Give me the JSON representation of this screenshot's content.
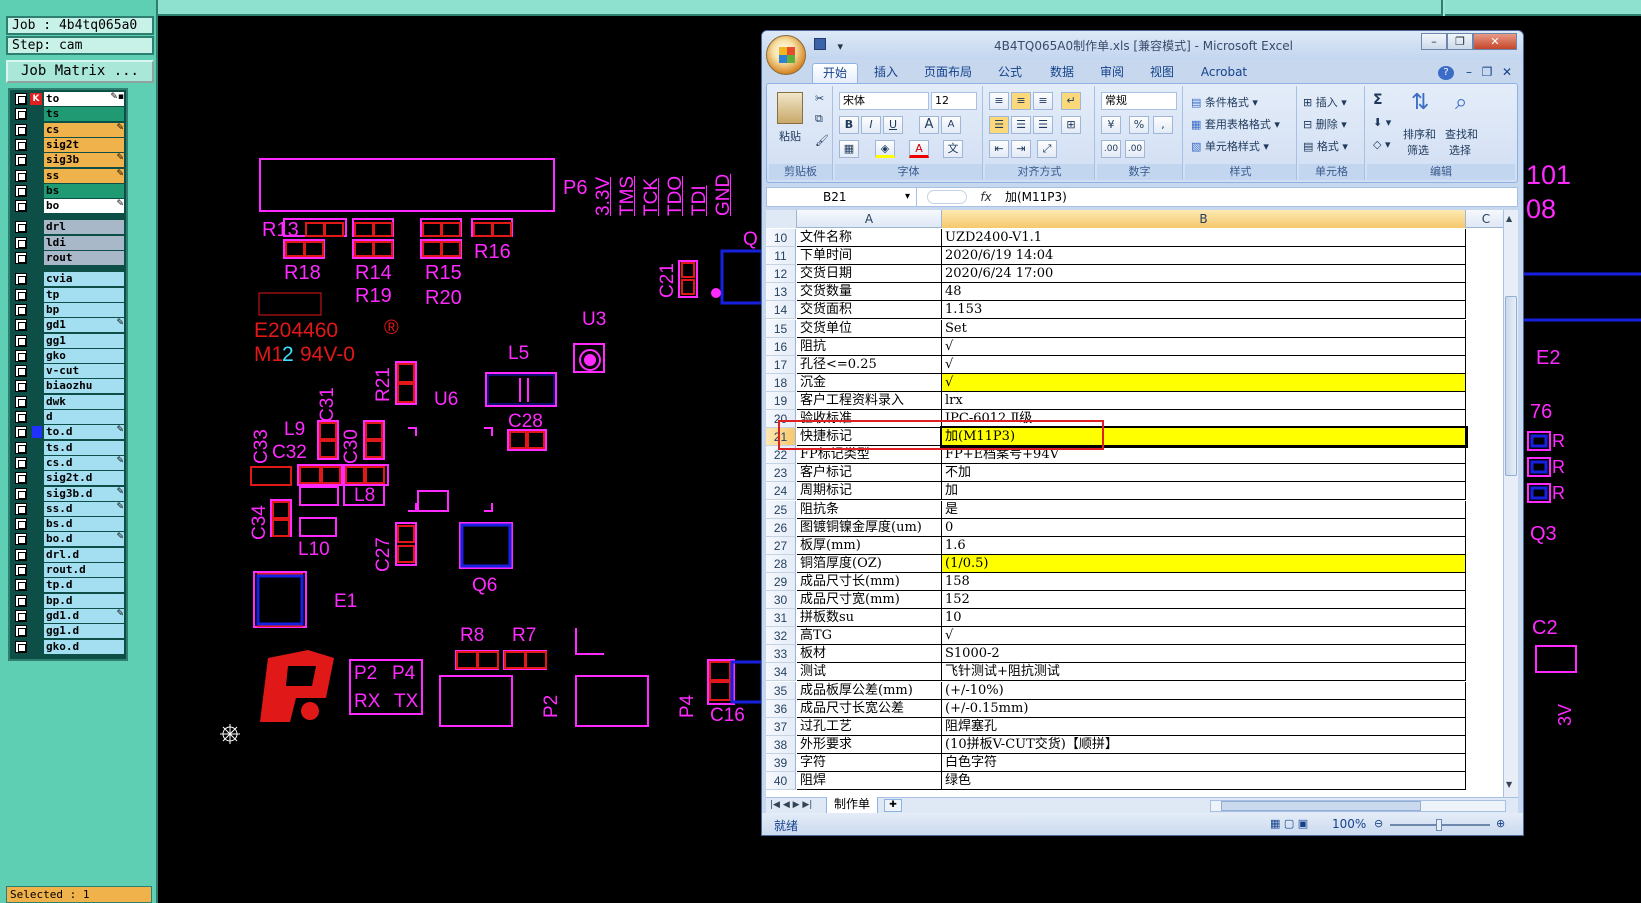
{
  "cam": {
    "job_label": "Job : 4b4tq065a0",
    "step_label": "Step: cam",
    "job_matrix_label": "Job Matrix ...",
    "selected_label": "Selected : 1",
    "colors": {
      "panel": "#5fcfb4",
      "signal": "#f0b24a",
      "mask": "#1f9a73",
      "drill": "#a9b8c8",
      "other": "#a3dff0"
    },
    "layers": [
      {
        "name": "to",
        "color": "#ffffff",
        "mark": "✎▪"
      },
      {
        "name": "ts",
        "color": "#1f9a73",
        "mark": ""
      },
      {
        "name": "cs",
        "color": "#f0b24a",
        "mark": "✎"
      },
      {
        "name": "sig2t",
        "color": "#f0b24a",
        "mark": ""
      },
      {
        "name": "sig3b",
        "color": "#f0b24a",
        "mark": "✎"
      },
      {
        "name": "ss",
        "color": "#f0b24a",
        "mark": "✎"
      },
      {
        "name": "bs",
        "color": "#1f9a73",
        "mark": ""
      },
      {
        "name": "bo",
        "color": "#ffffff",
        "mark": "✎"
      },
      {
        "name": "drl",
        "color": "#a9b8c8",
        "mark": ""
      },
      {
        "name": "ldi",
        "color": "#a9b8c8",
        "mark": ""
      },
      {
        "name": "rout",
        "color": "#a9b8c8",
        "mark": ""
      },
      {
        "name": "cvia",
        "color": "#a3dff0",
        "mark": ""
      },
      {
        "name": "tp",
        "color": "#a3dff0",
        "mark": ""
      },
      {
        "name": "bp",
        "color": "#a3dff0",
        "mark": ""
      },
      {
        "name": "gd1",
        "color": "#a3dff0",
        "mark": "✎"
      },
      {
        "name": "gg1",
        "color": "#a3dff0",
        "mark": ""
      },
      {
        "name": "gko",
        "color": "#a3dff0",
        "mark": ""
      },
      {
        "name": "v-cut",
        "color": "#a3dff0",
        "mark": ""
      },
      {
        "name": "biaozhu",
        "color": "#a3dff0",
        "mark": ""
      },
      {
        "name": "dwk",
        "color": "#a3dff0",
        "mark": ""
      },
      {
        "name": "d",
        "color": "#a3dff0",
        "mark": ""
      },
      {
        "name": "to.d",
        "color": "#a3dff0",
        "mark": "✎"
      },
      {
        "name": "ts.d",
        "color": "#a3dff0",
        "mark": ""
      },
      {
        "name": "cs.d",
        "color": "#a3dff0",
        "mark": "✎"
      },
      {
        "name": "sig2t.d",
        "color": "#a3dff0",
        "mark": ""
      },
      {
        "name": "sig3b.d",
        "color": "#a3dff0",
        "mark": "✎"
      },
      {
        "name": "ss.d",
        "color": "#a3dff0",
        "mark": "✎"
      },
      {
        "name": "bs.d",
        "color": "#a3dff0",
        "mark": ""
      },
      {
        "name": "bo.d",
        "color": "#a3dff0",
        "mark": "✎"
      },
      {
        "name": "drl.d",
        "color": "#a3dff0",
        "mark": ""
      },
      {
        "name": "rout.d",
        "color": "#a3dff0",
        "mark": ""
      },
      {
        "name": "tp.d",
        "color": "#a3dff0",
        "mark": ""
      },
      {
        "name": "bp.d",
        "color": "#a3dff0",
        "mark": ""
      },
      {
        "name": "gd1.d",
        "color": "#a3dff0",
        "mark": "✎"
      },
      {
        "name": "gg1.d",
        "color": "#a3dff0",
        "mark": ""
      },
      {
        "name": "gko.d",
        "color": "#a3dff0",
        "mark": ""
      }
    ]
  },
  "pcb": {
    "colors": {
      "silk": "#ff2aff",
      "pad": "#e01818",
      "copper": "#1820e0",
      "accent": "#40e0ff"
    },
    "labels": {
      "p6": "P6",
      "r13": "R13",
      "r18": "R18",
      "r14": "R14",
      "r19": "R19",
      "r15": "R15",
      "r20": "R20",
      "r16": "R16",
      "v33": "3.3V",
      "tms": "TMS",
      "tck": "TCK",
      "tdo": "TDO",
      "tdi": "TDI",
      "gnd": "GND",
      "c21": "C21",
      "q_partial": "Q",
      "u3": "U3",
      "l5": "L5",
      "r21": "R21",
      "u6": "U6",
      "c28": "C28",
      "c31": "C31",
      "l9": "L9",
      "c33": "C33",
      "c32": "C32",
      "c30": "C30",
      "l8": "L8",
      "c34": "C34",
      "l10": "L10",
      "c27": "C27",
      "q6": "Q6",
      "e1": "E1",
      "r8": "R8",
      "r7": "R7",
      "p2_small": "P2",
      "p4_small": "P4",
      "rx": "RX",
      "tx": "TX",
      "p2": "P2",
      "p4": "P4",
      "c16": "C16",
      "ul_num": "E204460",
      "m12_m": "M1",
      "m12_2": "2",
      "v0": "94V-0",
      "ul_r": "®",
      "right_101": "101",
      "right_08": "08",
      "right_e2": "E2",
      "right_76": "76",
      "right_r1": "R",
      "right_r2": "R",
      "right_r3": "R",
      "right_q3": "Q3",
      "right_c2": "C2",
      "right_3v": "3V"
    }
  },
  "excel": {
    "title": "4B4TQ065A0制作单.xls  [兼容模式] - Microsoft Excel",
    "tabs": [
      "开始",
      "插入",
      "页面布局",
      "公式",
      "数据",
      "审阅",
      "视图",
      "Acrobat"
    ],
    "window_buttons": {
      "minimize": "–",
      "restore": "❐",
      "close": "✕"
    },
    "ribbon": {
      "clipboard": {
        "paste": "粘贴",
        "label": "剪贴板"
      },
      "font": {
        "name": "宋体",
        "size": "12",
        "label": "字体",
        "bold": "B",
        "italic": "I",
        "underline": "U",
        "grow": "A",
        "shrink": "A",
        "wen": "文"
      },
      "alignment": {
        "label": "对齐方式"
      },
      "number": {
        "format": "常规",
        "percent": "%",
        "comma": ",",
        "inc_dec": ".00",
        "dec_dec": ".00",
        "label": "数字"
      },
      "styles": {
        "conditional": "条件格式",
        "table": "套用表格格式",
        "cell": "单元格样式",
        "label": "样式"
      },
      "cells": {
        "insert": "插入",
        "delete": "删除",
        "format": "格式",
        "label": "单元格"
      },
      "editing": {
        "sum": "Σ",
        "sort": "排序和",
        "sort2": "筛选",
        "find": "查找和",
        "find2": "选择",
        "label": "编辑"
      }
    },
    "formula_bar": {
      "name_box": "B21",
      "fx": "fx",
      "value": "加(M11P3)"
    },
    "columns": [
      "A",
      "B",
      "C"
    ],
    "rows": [
      {
        "n": "10",
        "a": "文件名称",
        "b": "UZD2400-V1.1",
        "hl": false
      },
      {
        "n": "11",
        "a": "下单时间",
        "b": "2020/6/19 14:04",
        "hl": false
      },
      {
        "n": "12",
        "a": "交货日期",
        "b": "2020/6/24 17:00",
        "hl": false
      },
      {
        "n": "13",
        "a": "交货数量",
        "b": "48",
        "hl": false
      },
      {
        "n": "14",
        "a": "交货面积",
        "b": "1.153",
        "hl": false
      },
      {
        "n": "15",
        "a": "交货单位",
        "b": "Set",
        "hl": false
      },
      {
        "n": "16",
        "a": "阻抗",
        "b": "√",
        "hl": false
      },
      {
        "n": "17",
        "a": "孔径<=0.25",
        "b": "√",
        "hl": false
      },
      {
        "n": "18",
        "a": "沉金",
        "b": "√",
        "hl": true
      },
      {
        "n": "19",
        "a": "客户工程资料录入",
        "b": "lrx",
        "hl": false
      },
      {
        "n": "20",
        "a": "验收标准",
        "b": "IPC-6012 Ⅱ级",
        "hl": false
      },
      {
        "n": "21",
        "a": "快捷标记",
        "b": "加(M11P3)",
        "hl": true
      },
      {
        "n": "22",
        "a": "FP标记类型",
        "b": "FP+E档案号+94V",
        "hl": false
      },
      {
        "n": "23",
        "a": "客户标记",
        "b": "不加",
        "hl": false
      },
      {
        "n": "24",
        "a": "周期标记",
        "b": "加",
        "hl": false
      },
      {
        "n": "25",
        "a": "阻抗条",
        "b": "是",
        "hl": false
      },
      {
        "n": "26",
        "a": "图镀铜镍金厚度(um)",
        "b": "0",
        "hl": false
      },
      {
        "n": "27",
        "a": "板厚(mm)",
        "b": "1.6",
        "hl": false
      },
      {
        "n": "28",
        "a": "铜箔厚度(OZ)",
        "b": "(1/0.5)",
        "hl": true
      },
      {
        "n": "29",
        "a": "成品尺寸长(mm)",
        "b": "158",
        "hl": false
      },
      {
        "n": "30",
        "a": "成品尺寸宽(mm)",
        "b": "152",
        "hl": false
      },
      {
        "n": "31",
        "a": "拼板数su",
        "b": "10",
        "hl": false
      },
      {
        "n": "32",
        "a": "高TG",
        "b": "√",
        "hl": false
      },
      {
        "n": "33",
        "a": "板材",
        "b": "S1000-2",
        "hl": false
      },
      {
        "n": "34",
        "a": "测试",
        "b": "飞针测试+阻抗测试",
        "hl": false
      },
      {
        "n": "35",
        "a": "成品板厚公差(mm)",
        "b": "(+/-10%)",
        "hl": false
      },
      {
        "n": "36",
        "a": "成品尺寸长宽公差",
        "b": "(+/-0.15mm)",
        "hl": false
      },
      {
        "n": "37",
        "a": "过孔工艺",
        "b": "阻焊塞孔",
        "hl": false
      },
      {
        "n": "38",
        "a": "外形要求",
        "b": "(10拼板V-CUT交货)【顺拼】",
        "hl": false
      },
      {
        "n": "39",
        "a": "字符",
        "b": "白色字符",
        "hl": false
      },
      {
        "n": "40",
        "a": "阻焊",
        "b": "绿色",
        "hl": false
      }
    ],
    "sheet_tab": "制作单",
    "status": {
      "ready": "就绪",
      "zoom": "100%"
    }
  }
}
